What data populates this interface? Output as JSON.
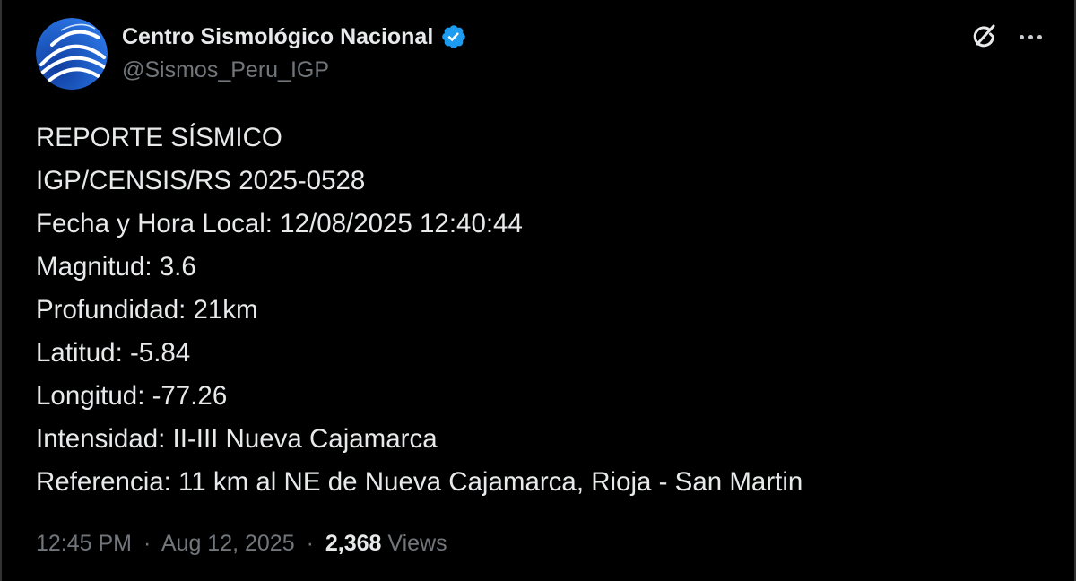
{
  "author": {
    "display_name": "Centro Sismológico Nacional",
    "handle": "@Sismos_Peru_IGP",
    "verified": true,
    "avatar_icon": "igp-logo-icon"
  },
  "actions": {
    "grok_icon": "grok-icon",
    "more_icon": "more-options-icon"
  },
  "post": {
    "lines": [
      "REPORTE SÍSMICO",
      "IGP/CENSIS/RS 2025-0528",
      "Fecha y Hora Local: 12/08/2025 12:40:44",
      "Magnitud: 3.6",
      "Profundidad: 21km",
      "Latitud: -5.84",
      "Longitud: -77.26",
      "Intensidad: II-III Nueva Cajamarca",
      "Referencia: 11 km al NE de Nueva Cajamarca, Rioja - San Martin"
    ]
  },
  "meta": {
    "time": "12:45 PM",
    "separator": "·",
    "date": "Aug 12, 2025",
    "views_count": "2,368",
    "views_label": "Views"
  },
  "colors": {
    "background": "#000000",
    "text": "#e7e9ea",
    "secondary": "#71767b",
    "verified": "#1d9bf0",
    "avatar_bg": "#1b5fd0"
  }
}
